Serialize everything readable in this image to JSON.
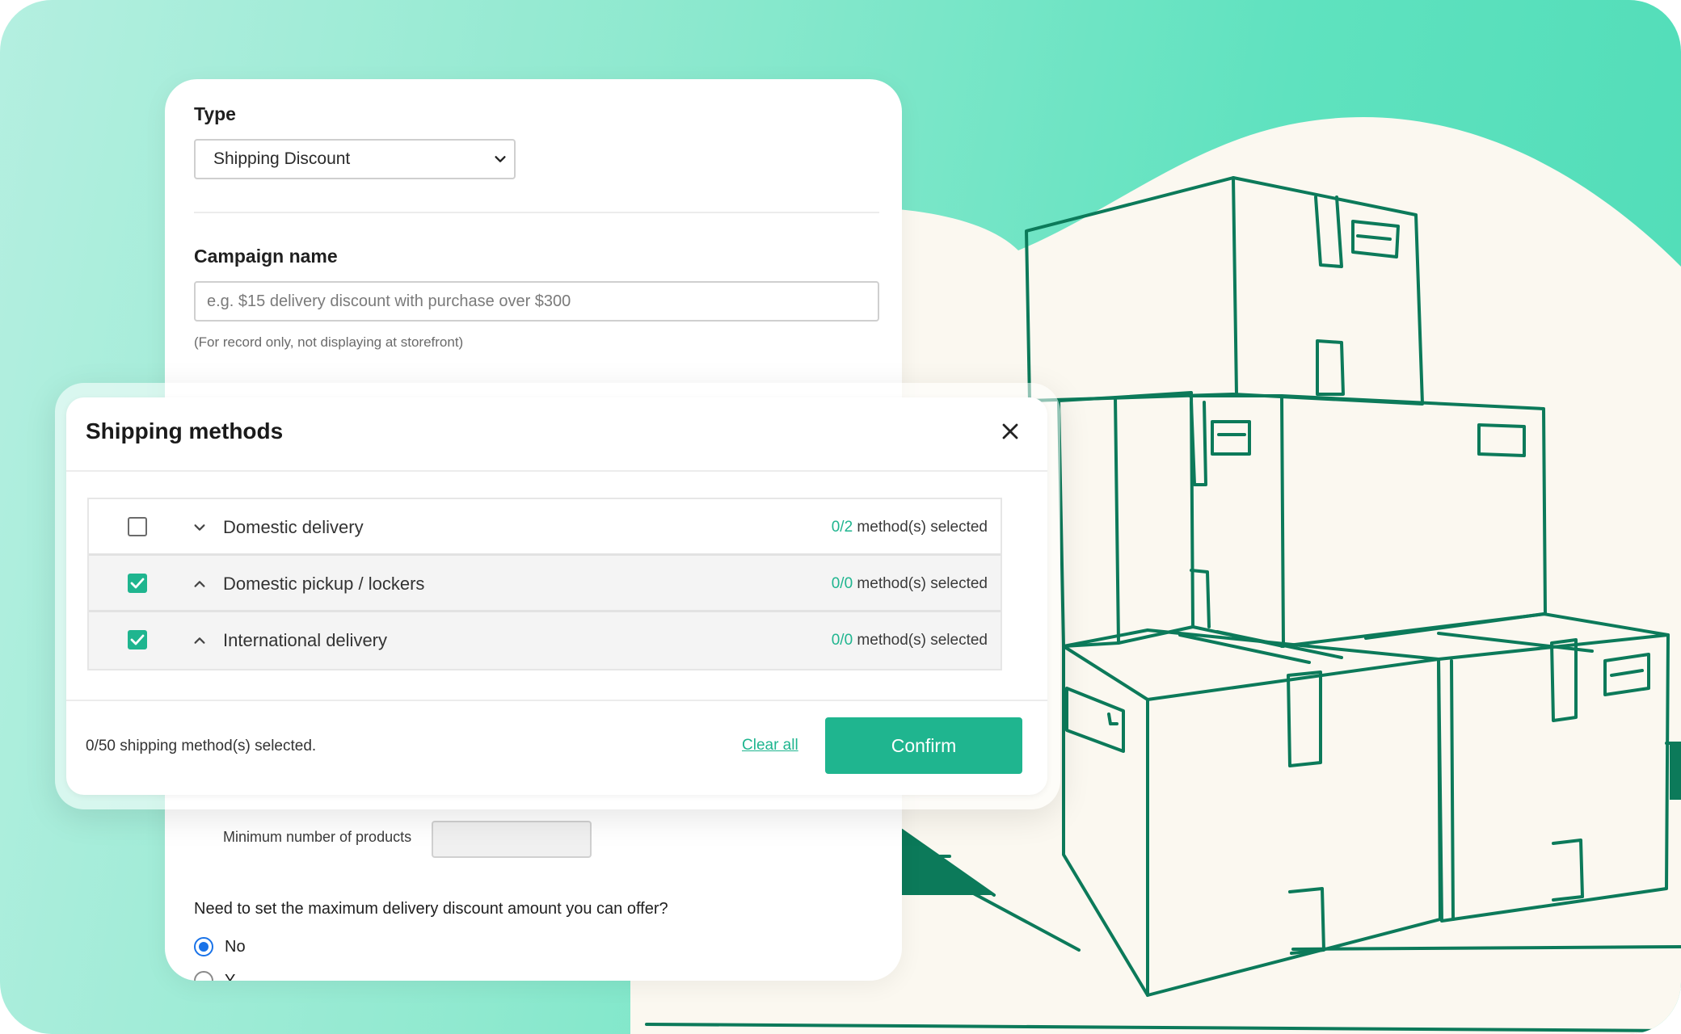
{
  "form": {
    "type_label": "Type",
    "type_value": "Shipping Discount",
    "campaign_label": "Campaign name",
    "campaign_placeholder": "e.g. $15 delivery discount with purchase over $300",
    "campaign_hint": "(For record only, not displaying at storefront)",
    "min_products_label": "Minimum number of products",
    "max_discount_question": "Need to set the maximum delivery discount amount you can offer?",
    "radio_no": "No",
    "radio_yes_partial": "Y"
  },
  "modal": {
    "title": "Shipping methods",
    "groups": [
      {
        "label": "Domestic delivery",
        "count": "0/2",
        "suffix": "method(s) selected",
        "checked": false,
        "expanded": false
      },
      {
        "label": "Domestic pickup / lockers",
        "count": "0/0",
        "suffix": "method(s) selected",
        "checked": true,
        "expanded": true
      },
      {
        "label": "International delivery",
        "count": "0/0",
        "suffix": "method(s) selected",
        "checked": true,
        "expanded": true
      }
    ],
    "summary": "0/50 shipping method(s) selected.",
    "clear_all": "Clear all",
    "confirm": "Confirm"
  },
  "colors": {
    "accent": "#1fb58f",
    "illustration_stroke": "#0c7a5a",
    "cream": "#fbf8f0"
  },
  "icons": {
    "close": "close-icon",
    "chevron_down": "chevron-down-icon",
    "chevron_up": "chevron-up-icon",
    "check": "check-icon"
  }
}
